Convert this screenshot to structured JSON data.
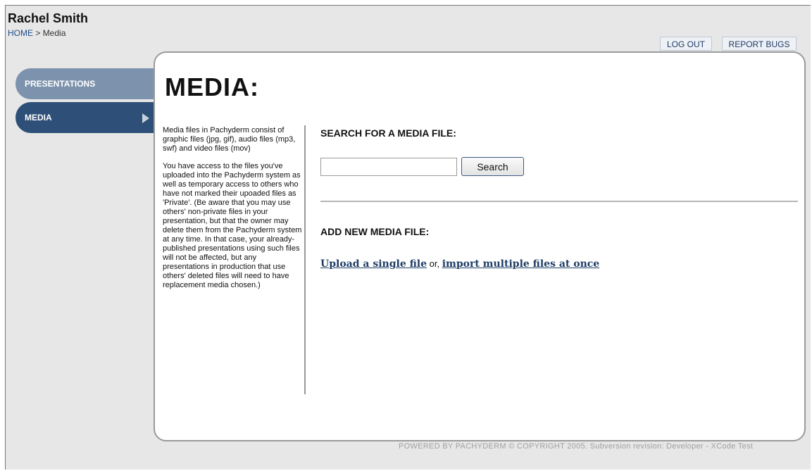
{
  "header": {
    "user_name": "Rachel Smith",
    "breadcrumb": {
      "home": "HOME",
      "separator": " > ",
      "current": "Media"
    },
    "buttons": {
      "logout": "LOG OUT",
      "report_bugs": "REPORT BUGS"
    }
  },
  "sidebar": {
    "items": [
      {
        "label": "PRESENTATIONS",
        "active": false
      },
      {
        "label": "MEDIA",
        "active": true
      }
    ]
  },
  "main": {
    "title": "MEDIA:",
    "description": [
      "Media files in Pachyderm consist of graphic files (jpg, gif), audio files (mp3, swf) and video files (mov)",
      "You have access to the files you've uploaded into the Pachyderm system as well as temporary access to others who have not marked their upoaded files as 'Private'. (Be aware that you may use others' non-private files in your presentation, but that the owner may delete them from the Pachyderm system at any time. In that case, your already-published presentations using such files will not be affected, but any presentations in production that use others' deleted files will need to have replacement media chosen.)"
    ],
    "search": {
      "heading": "SEARCH FOR A MEDIA FILE:",
      "input_value": "",
      "button_label": "Search"
    },
    "add": {
      "heading": "ADD NEW MEDIA FILE:",
      "upload_single": "Upload a single file",
      "separator": " or, ",
      "import_multiple": "import multiple files at once"
    }
  },
  "footer": {
    "text": "POWERED BY PACHYDERM © COPYRIGHT 2005. Subversion revision: Developer - XCode Test"
  },
  "colors": {
    "background": "#e7e7e7",
    "nav_inactive": "#7d93ad",
    "nav_active": "#2e4f77",
    "link": "#1f3c66"
  }
}
